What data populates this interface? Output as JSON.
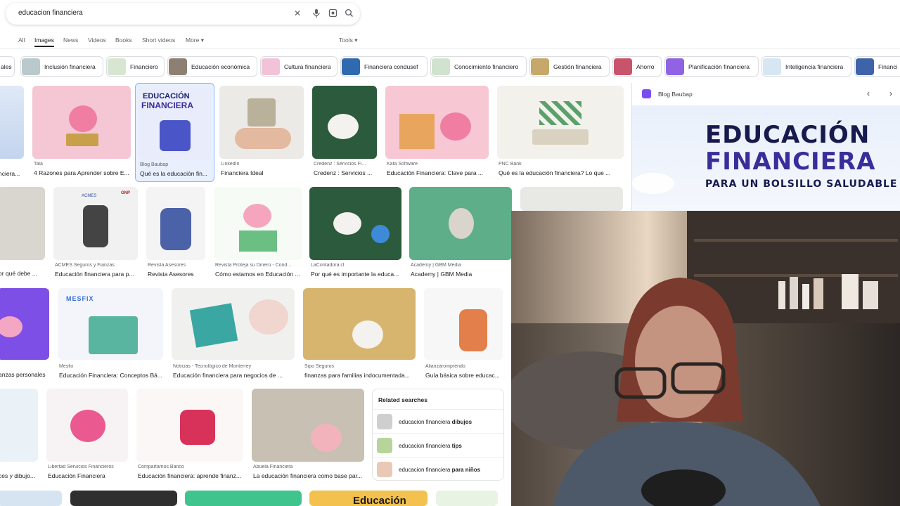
{
  "search": {
    "query": "educacion financiera"
  },
  "tabs": [
    "All",
    "Images",
    "News",
    "Videos",
    "Books",
    "Short videos",
    "More",
    "Tools"
  ],
  "chips": [
    "ales",
    "Inclusión financiera",
    "Financiero",
    "Educación económica",
    "Cultura financiera",
    "Financiera condusef",
    "Conocimiento financiero",
    "Gestión financiera",
    "Ahorro",
    "Planificación financiera",
    "Inteligencia financiera",
    "Financi"
  ],
  "results": [
    {
      "source": "",
      "title": "nciera..."
    },
    {
      "source": "Tala",
      "title": "4 Razones para Aprender sobre E..."
    },
    {
      "source": "Blog Baubap",
      "title": "Qué es la educación fin..."
    },
    {
      "source": "LinkedIn",
      "title": "Financiera Ideal"
    },
    {
      "source": "Credenz : Servicios Fi...",
      "title": "Credenz : Servicios ..."
    },
    {
      "source": "Kata Software",
      "title": "Educación Financiera: Clave para ..."
    },
    {
      "source": "PNC Bank",
      "title": "Qué es la educación financiera? Lo que ..."
    },
    {
      "source": "",
      "title": "or qué debe ..."
    },
    {
      "source": "ACMES Seguros y Fianzas",
      "title": "Educación financiera para p..."
    },
    {
      "source": "Revista Asesores",
      "title": "Revista Asesores"
    },
    {
      "source": "Revista Proteja su Dinero - Cond...",
      "title": "Cómo estamos en Educación ..."
    },
    {
      "source": "LaContadora.cl",
      "title": "Por qué es importante la educa..."
    },
    {
      "source": "Academy | GBM Media",
      "title": "Academy | GBM Media"
    },
    {
      "source": "",
      "title": "anzas personales"
    },
    {
      "source": "Mesfix",
      "title": "Educación Financiera: Conceptos Bá..."
    },
    {
      "source": "Noticias - Tecnológico de Monterrey",
      "title": "Educación financiera para negocios de ..."
    },
    {
      "source": "Sipo Seguros",
      "title": "finanzas para familias indocumentada..."
    },
    {
      "source": "Alianzaromprendo",
      "title": "Guía básica sobre educac..."
    },
    {
      "source": "",
      "title": "ces y dibujo..."
    },
    {
      "source": "Libertad Servicios Financieros",
      "title": "Educación Financiera"
    },
    {
      "source": "Compartamos Banco",
      "title": "Educación financiera: aprende finanz..."
    },
    {
      "source": "Abuela Financiera",
      "title": "La educación financiera como base par..."
    }
  ],
  "image_text": {
    "card2": [
      "EDUCACIÓN",
      "FINANCIERA"
    ],
    "acmes_badge": "ACMES",
    "gnp_badge": "GNP",
    "mesfix_logo": "MESFIX",
    "bottom_book": "Educación"
  },
  "related": {
    "heading": "Related searches",
    "items": [
      {
        "prefix": "educacion financiera ",
        "bold": "dibujos"
      },
      {
        "prefix": "educacion financiera ",
        "bold": "tips"
      },
      {
        "prefix": "educacion financiera ",
        "bold": "para niños"
      }
    ]
  },
  "preview": {
    "site": "Blog Baubap",
    "line1": "EDUCACIÓN",
    "line2": "FINANCIERA",
    "line3": "PARA UN BOLSILLO SALUDABLE"
  },
  "icons": [
    "close-icon",
    "mic-icon",
    "camera-icon",
    "search-icon",
    "chevron-left-icon",
    "chevron-right-icon"
  ]
}
